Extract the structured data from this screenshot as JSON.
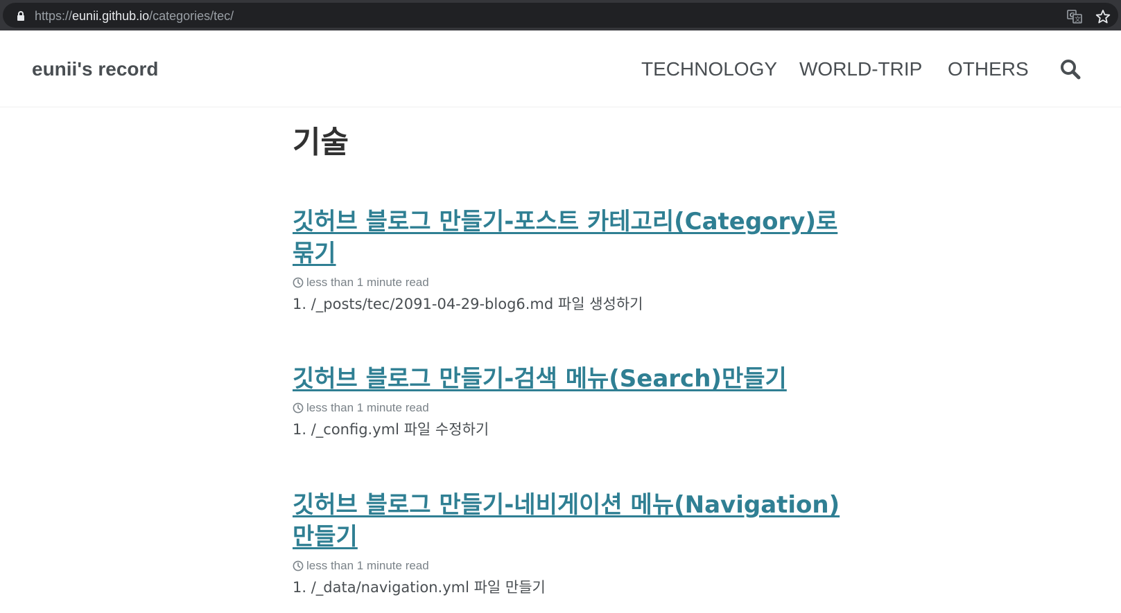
{
  "browser": {
    "url_scheme": "https://",
    "url_host": "eunii.github.io",
    "url_path": "/categories/tec/",
    "icons": [
      "lock-icon",
      "translate-icon",
      "star-icon"
    ]
  },
  "site": {
    "title": "eunii's record",
    "nav": [
      {
        "label": "TECHNOLOGY"
      },
      {
        "label": "WORLD-TRIP"
      },
      {
        "label": "OTHERS"
      }
    ],
    "search_icon": "search-icon"
  },
  "page": {
    "title": "기술",
    "posts": [
      {
        "title": "깃허브 블로그 만들기-포스트 카테고리(Category)로 묶기",
        "read_time": "less than 1 minute read",
        "excerpt": "1. /_posts/tec/2091-04-29-blog6.md 파일 생성하기"
      },
      {
        "title": "깃허브 블로그 만들기-검색 메뉴(Search)만들기",
        "read_time": "less than 1 minute read",
        "excerpt": "1. /_config.yml 파일 수정하기"
      },
      {
        "title": "깃허브 블로그 만들기-네비게이션 메뉴(Navigation)만들기",
        "read_time": "less than 1 minute read",
        "excerpt": "1. /_data/navigation.yml 파일 만들기"
      }
    ]
  },
  "colors": {
    "link": "#2f7f93",
    "text": "#494e52",
    "meta": "#7a8288",
    "browser_bar": "#35363a",
    "omnibox": "#202124"
  }
}
